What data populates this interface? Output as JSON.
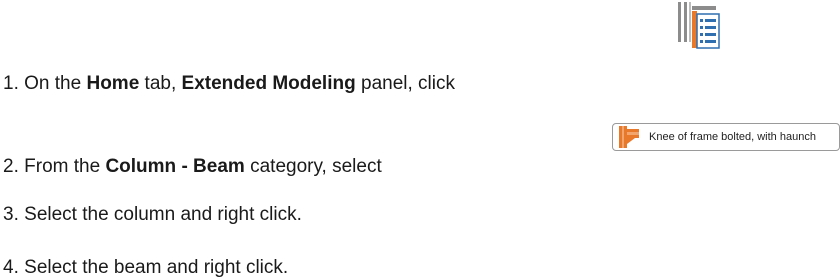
{
  "steps": [
    {
      "number": "1.",
      "pre": "On the",
      "tab": "Home",
      "mid": "tab,",
      "panel": "Extended Modeling",
      "post": "panel, click"
    },
    {
      "number": "2.",
      "pre": "From the",
      "category": "Column - Beam",
      "post": "category, select"
    },
    {
      "number": "3.",
      "text": "Select the column and right click."
    },
    {
      "number": "4.",
      "text": "Select the beam and right click."
    }
  ],
  "icons": {
    "tool": "connection-list-icon",
    "connection": "knee-of-frame-icon"
  },
  "selection_item": {
    "label": "Knee of frame bolted, with haunch"
  },
  "colors": {
    "text": "#1a1a1a",
    "icon_orange": "#e8782a",
    "icon_gray": "#8c8c8c",
    "icon_blue": "#2f6fb0"
  }
}
